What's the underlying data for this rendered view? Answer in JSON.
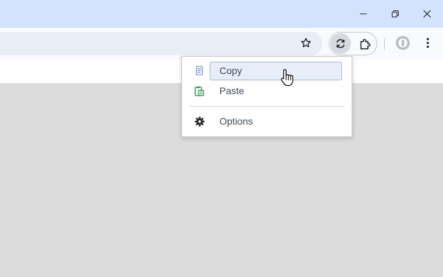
{
  "window": {
    "controls": [
      "minimize-icon",
      "restore-icon",
      "close-icon"
    ]
  },
  "toolbar": {
    "icons": [
      "star-icon",
      "sync-extension-icon",
      "puzzle-extensions-icon",
      "profile-avatar-icon",
      "more-menu-icon"
    ]
  },
  "popup_menu": {
    "items": [
      {
        "label": "Copy",
        "icon": "copy-document-icon",
        "hovered": true
      },
      {
        "label": "Paste",
        "icon": "paste-clipboard-icon",
        "hovered": false
      },
      {
        "label": "Options",
        "icon": "gear-icon",
        "hovered": false
      }
    ]
  },
  "colors": {
    "titlebar": "#d3e3fd",
    "toolbar": "#f8fafd",
    "page_background": "#dcdcdc",
    "hover_highlight": "#e8eef7",
    "copy_icon": "#6b8fc4",
    "paste_icon": "#1e8e3e",
    "gear_icon": "#202124"
  }
}
